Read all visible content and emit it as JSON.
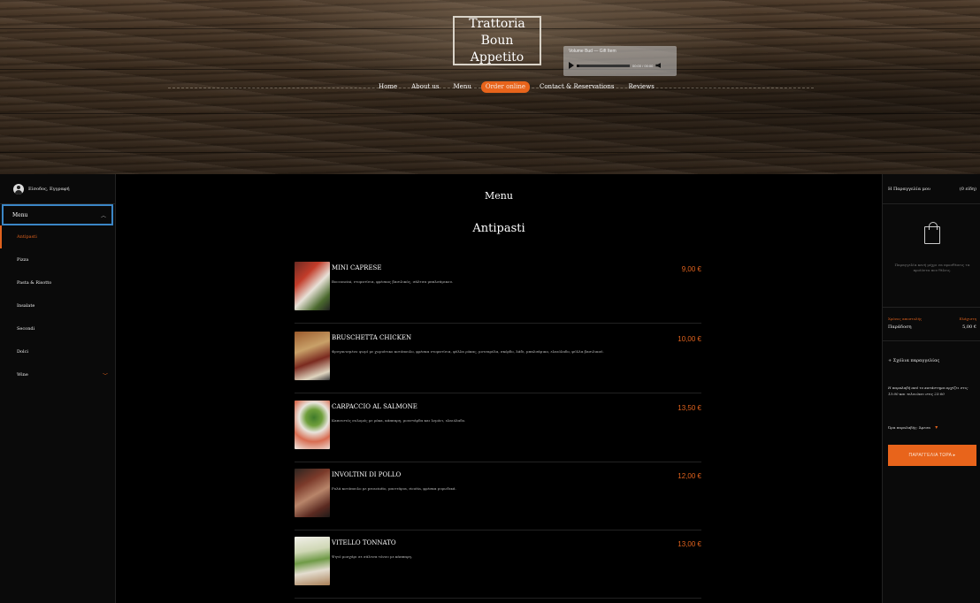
{
  "brand": {
    "line1": "Trattoria",
    "line2": "Boun Appetito"
  },
  "audio": {
    "title": "Volume Bud — Gift Item",
    "time": "00:00 / 00:00",
    "progress": 0.05
  },
  "nav": {
    "items": [
      {
        "label": "Home",
        "active": false
      },
      {
        "label": "About us",
        "active": false
      },
      {
        "label": "Menu",
        "active": false
      },
      {
        "label": "Order online",
        "active": true
      },
      {
        "label": "Contact & Reservations",
        "active": false
      },
      {
        "label": "Reviews",
        "active": false
      }
    ]
  },
  "sidebar": {
    "login": "Είσοδος, Εγγραφή",
    "menu_label": "Menu",
    "categories": [
      {
        "label": "Antipasti",
        "active": true,
        "expandable": false
      },
      {
        "label": "Pizza",
        "active": false,
        "expandable": false
      },
      {
        "label": "Pasta & Risotto",
        "active": false,
        "expandable": false
      },
      {
        "label": "Insalate",
        "active": false,
        "expandable": false
      },
      {
        "label": "Secondi",
        "active": false,
        "expandable": false
      },
      {
        "label": "Dolci",
        "active": false,
        "expandable": false
      },
      {
        "label": "Wine",
        "active": false,
        "expandable": true
      }
    ]
  },
  "main": {
    "title": "Menu",
    "section": "Antipasti",
    "dishes": [
      {
        "name": "MINI CAPRESE",
        "description": "Bocconcini, ντοματίνια, φρέσκος βασιλικός, σάλτσα μπαλσάμικου.",
        "price": "9,00 €"
      },
      {
        "name": "BRUSCHETTA CHICKEN",
        "description": "Φρυγανισμένο ψωμί με χωριάτικο κοτόπουλο, φρέσκα ντοματίνια, φύλλα ρόκας, μοτσαρέλα, σκόρδο, λάδι, μπαλσάμικο, ελαιόλαδο, φύλλα βασιλικού.",
        "price": "10,00 €"
      },
      {
        "name": "CARPACCIO AL SALMONE",
        "description": "Καπνιστός σολομός με ρόκα, κάππαρη, μουστάρδα και λεμόνι, ελαιόλαδο.",
        "price": "13,50 €"
      },
      {
        "name": "INVOLTINI DI POLLO",
        "description": "Ρολά κοτόπουλο με prosciutto, μανιτάρια, ricotta, φρέσκα μυρωδικά.",
        "price": "12,00 €"
      },
      {
        "name": "VITELLO TONNATO",
        "description": "Ψητό μοσχάρι σε σάλτσα τόνου με κάππαρη.",
        "price": "13,00 €"
      }
    ]
  },
  "cart": {
    "title": "Η Παραγγελία μου",
    "count": "(0 είδη)",
    "empty_text": "Παραγγελία κενή μέχρι να προσθέσεις τα προϊόντα που θέλεις.",
    "delivery_label": "Χρόνος αποστολής",
    "delivery_value": "Παράδοση",
    "min_label": "Ελάχιστη",
    "min_value": "5,00 €",
    "comments": "+ Σχόλια παραγγελίας",
    "hours_note": "Η παραλαβή από το κατάστημα αρχίζει στις 13:00 και τελειώνει στις 23:00",
    "time_label": "Ώρα παραλαβής: Άμεσα",
    "order_button": "ΠΑΡΑΓΓΕΛΙΑ ΤΩΡΑ ▸"
  },
  "colors": {
    "accent": "#e8641b",
    "focus": "#3b86c6",
    "background": "#000000"
  }
}
